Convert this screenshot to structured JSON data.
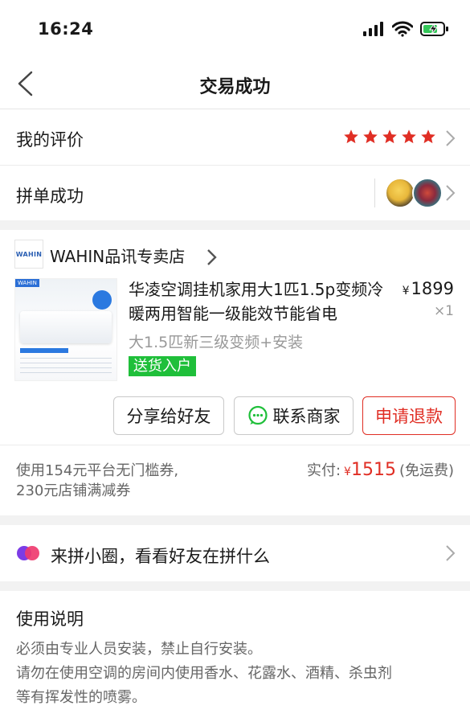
{
  "status_bar": {
    "time": "16:24"
  },
  "nav": {
    "title": "交易成功"
  },
  "review": {
    "label": "我的评价",
    "rating": 5,
    "star_color": "#e02e24"
  },
  "group_buy": {
    "label": "拼单成功"
  },
  "store": {
    "logo_text": "WAHIN",
    "name": "WAHIN品讯专卖店"
  },
  "product": {
    "title": "华凌空调挂机家用大1匹1.5p变频冷暖两用智能一级能效节能省电",
    "price_symbol": "¥",
    "price": "1899",
    "quantity": "×1",
    "spec": "大1.5匹新三级变频+安装",
    "tag": "送货入户",
    "tag_color": "#1fbf3a",
    "image_brand": "WAHIN"
  },
  "actions": {
    "share": "分享给好友",
    "contact": "联系商家",
    "refund": "申请退款",
    "refund_color": "#e02e24"
  },
  "payment": {
    "coupon_line1": "使用154元平台无门槛券,",
    "coupon_line2": "230元店铺满减券",
    "paid_label": "实付:",
    "paid_symbol": "¥",
    "paid_amount": "1515",
    "shipping": "(免运费)",
    "accent": "#e02e24"
  },
  "circle": {
    "text": "来拼小圈，看看好友在拼什么"
  },
  "usage": {
    "title": "使用说明",
    "line1": "必须由专业人员安装，禁止自行安装。",
    "line2": "请勿在使用空调的房间内使用香水、花露水、酒精、杀虫剂",
    "line3": "等有挥发性的喷雾。"
  }
}
